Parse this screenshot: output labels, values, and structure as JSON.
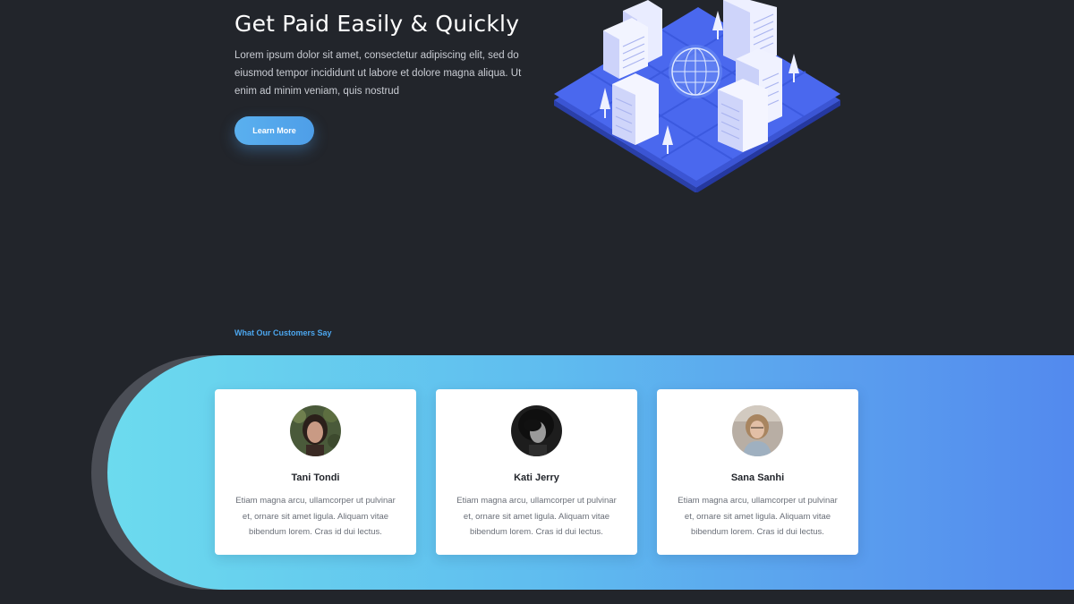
{
  "hero": {
    "title": "Get Paid Easily & Quickly",
    "text": "Lorem ipsum dolor sit amet, consectetur adipiscing elit, sed do eiusmod tempor incididunt ut labore et dolore magna aliqua. Ut enim ad minim veniam, quis nostrud",
    "button_label": "Learn More",
    "illustration_icon": "isometric-city-globe-illustration"
  },
  "testimonials": {
    "section_label": "What Our Customers Say",
    "items": [
      {
        "name": "Tani Tondi",
        "quote": "Etiam magna arcu, ullamcorper ut pulvinar et, ornare sit amet ligula. Aliquam vitae bibendum lorem. Cras id dui lectus.",
        "avatar_icon": "customer-photo"
      },
      {
        "name": "Kati Jerry",
        "quote": "Etiam magna arcu, ullamcorper ut pulvinar et, ornare sit amet ligula. Aliquam vitae bibendum lorem. Cras id dui lectus.",
        "avatar_icon": "customer-photo"
      },
      {
        "name": "Sana Sanhi",
        "quote": "Etiam magna arcu, ullamcorper ut pulvinar et, ornare sit amet ligula. Aliquam vitae bibendum lorem. Cras id dui lectus.",
        "avatar_icon": "customer-photo"
      }
    ]
  },
  "colors": {
    "background": "#22252b",
    "accent": "#4e9ee8",
    "band_start": "#6cdbee",
    "band_end": "#5288ee",
    "card": "#ffffff"
  }
}
